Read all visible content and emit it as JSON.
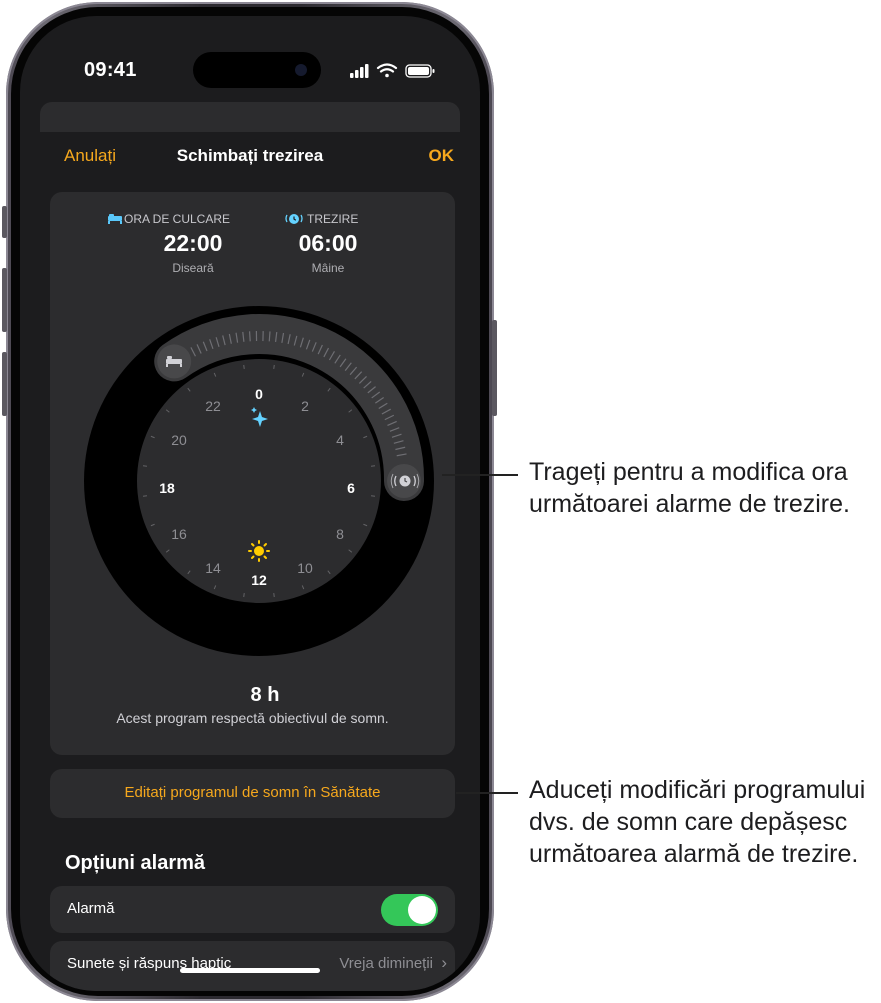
{
  "status_bar": {
    "time": "09:41"
  },
  "nav": {
    "cancel": "Anulați",
    "title": "Schimbați trezirea",
    "done": "OK"
  },
  "schedule": {
    "bedtime": {
      "label": "ORA DE CULCARE",
      "time": "22:00",
      "day": "Diseară"
    },
    "wake": {
      "label": "TREZIRE",
      "time": "06:00",
      "day": "Mâine"
    },
    "clock_numbers": [
      "0",
      "2",
      "4",
      "6",
      "8",
      "10",
      "12",
      "14",
      "16",
      "18",
      "20",
      "22"
    ],
    "duration": "8 h",
    "note": "Acest program respectă obiectivul de somn."
  },
  "edit_button": "Editați programul de somn în Sănătate",
  "alarm_options": {
    "title": "Opțiuni alarmă",
    "alarm_label": "Alarmă",
    "alarm_on": true,
    "sounds_label": "Sunete și răspuns haptic",
    "sounds_value": "Vreja dimineții"
  },
  "callouts": [
    "Trageți pentru a modifica ora următoarei alarme de trezire.",
    "Aduceți modificări programului dvs. de somn care depășesc următoarea alarmă de trezire."
  ],
  "colors": {
    "accent": "#f6a81d",
    "toggle_on": "#34c759",
    "bed_icon": "#5ac8fa",
    "sparkle": "#64d2ff",
    "sun": "#ffcc00"
  }
}
